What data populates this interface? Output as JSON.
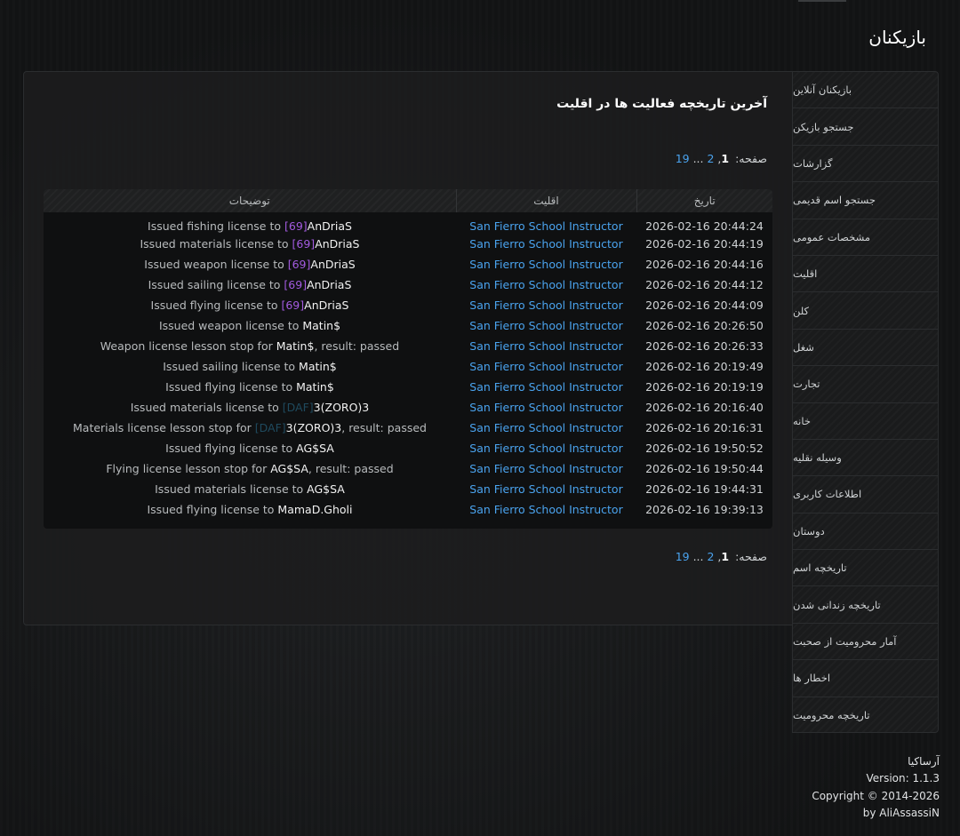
{
  "header": {
    "title": "بازیکنان"
  },
  "main": {
    "section_title": "آخرین تاریخچه فعالیت ها در اقلیت",
    "pagination": {
      "label": "صفحه:",
      "current": "1",
      "sep1": ",",
      "page2": "2",
      "ellipsis": " ... ",
      "last": "19"
    },
    "table": {
      "columns": [
        "توضیحات",
        "اقلیت",
        "تاریخ"
      ],
      "rows": [
        {
          "pre": "Issued fishing license to ",
          "tag": "[69]",
          "tag_color": "#a35be0",
          "name": "AnDriaS",
          "post": "",
          "faction": "San Fierro School Instructor",
          "date": "2026-02-16 20:44:24"
        },
        {
          "pre": "Issued materials license to ",
          "tag": "[69]",
          "tag_color": "#a35be0",
          "name": "AnDriaS",
          "post": "",
          "faction": "San Fierro School Instructor",
          "date": "2026-02-16 20:44:19"
        },
        {
          "pre": "Issued weapon license to ",
          "tag": "[69]",
          "tag_color": "#a35be0",
          "name": "AnDriaS",
          "post": "",
          "faction": "San Fierro School Instructor",
          "date": "2026-02-16 20:44:16"
        },
        {
          "pre": "Issued sailing license to ",
          "tag": "[69]",
          "tag_color": "#a35be0",
          "name": "AnDriaS",
          "post": "",
          "faction": "San Fierro School Instructor",
          "date": "2026-02-16 20:44:12"
        },
        {
          "pre": "Issued flying license to ",
          "tag": "[69]",
          "tag_color": "#a35be0",
          "name": "AnDriaS",
          "post": "",
          "faction": "San Fierro School Instructor",
          "date": "2026-02-16 20:44:09"
        },
        {
          "pre": "Issued weapon license to ",
          "tag": "",
          "tag_color": "",
          "name": "Matin$",
          "post": "",
          "faction": "San Fierro School Instructor",
          "date": "2026-02-16 20:26:50"
        },
        {
          "pre": "Weapon license lesson stop for ",
          "tag": "",
          "tag_color": "",
          "name": "Matin$",
          "post": ", result: passed",
          "faction": "San Fierro School Instructor",
          "date": "2026-02-16 20:26:33"
        },
        {
          "pre": "Issued sailing license to ",
          "tag": "",
          "tag_color": "",
          "name": "Matin$",
          "post": "",
          "faction": "San Fierro School Instructor",
          "date": "2026-02-16 20:19:49"
        },
        {
          "pre": "Issued flying license to ",
          "tag": "",
          "tag_color": "",
          "name": "Matin$",
          "post": "",
          "faction": "San Fierro School Instructor",
          "date": "2026-02-16 20:19:19"
        },
        {
          "pre": "Issued materials license to ",
          "tag": "[DAF]",
          "tag_color": "#1f4a5e",
          "name": "3(ZORO)3",
          "post": "",
          "faction": "San Fierro School Instructor",
          "date": "2026-02-16 20:16:40"
        },
        {
          "pre": "Materials license lesson stop for ",
          "tag": "[DAF]",
          "tag_color": "#1f4a5e",
          "name": "3(ZORO)3",
          "post": ", result: passed",
          "faction": "San Fierro School Instructor",
          "date": "2026-02-16 20:16:31"
        },
        {
          "pre": "Issued flying license to ",
          "tag": "",
          "tag_color": "",
          "name": "AG$SA",
          "post": "",
          "faction": "San Fierro School Instructor",
          "date": "2026-02-16 19:50:52"
        },
        {
          "pre": "Flying license lesson stop for ",
          "tag": "",
          "tag_color": "",
          "name": "AG$SA",
          "post": ", result: passed",
          "faction": "San Fierro School Instructor",
          "date": "2026-02-16 19:50:44"
        },
        {
          "pre": "Issued materials license to ",
          "tag": "",
          "tag_color": "",
          "name": "AG$SA",
          "post": "",
          "faction": "San Fierro School Instructor",
          "date": "2026-02-16 19:44:31"
        },
        {
          "pre": "Issued flying license to ",
          "tag": "",
          "tag_color": "",
          "name": "MamaD.Gholi",
          "post": "",
          "faction": "San Fierro School Instructor",
          "date": "2026-02-16 19:39:13"
        }
      ]
    }
  },
  "sidebar": {
    "items": [
      {
        "label": "بازیکنان آنلاین"
      },
      {
        "label": "جستجو بازیکن"
      },
      {
        "label": "گزارشات"
      },
      {
        "label": "جستجو اسم قدیمی"
      },
      {
        "label": "مشخصات عمومی"
      },
      {
        "label": "اقلیت"
      },
      {
        "label": "کلن"
      },
      {
        "label": "شغل"
      },
      {
        "label": "تجارت"
      },
      {
        "label": "خانه"
      },
      {
        "label": "وسیله نقلیه"
      },
      {
        "label": "اطلاعات کاربری"
      },
      {
        "label": "دوستان"
      },
      {
        "label": "تاریخچه اسم"
      },
      {
        "label": "تاریخچه زندانی شدن"
      },
      {
        "label": "آمار محرومیت از صحبت"
      },
      {
        "label": "اخطار ها"
      },
      {
        "label": "تاریخچه محرومیت"
      }
    ]
  },
  "footer": {
    "brand": "آرساکیا",
    "version": "Version: 1.1.3",
    "copyright": "Copyright © 2014-2026",
    "author": "by AliAssassiN"
  },
  "colors": {
    "link": "#4aa3ee",
    "tag_purple": "#a35be0",
    "tag_dim": "#1f4a5e"
  }
}
